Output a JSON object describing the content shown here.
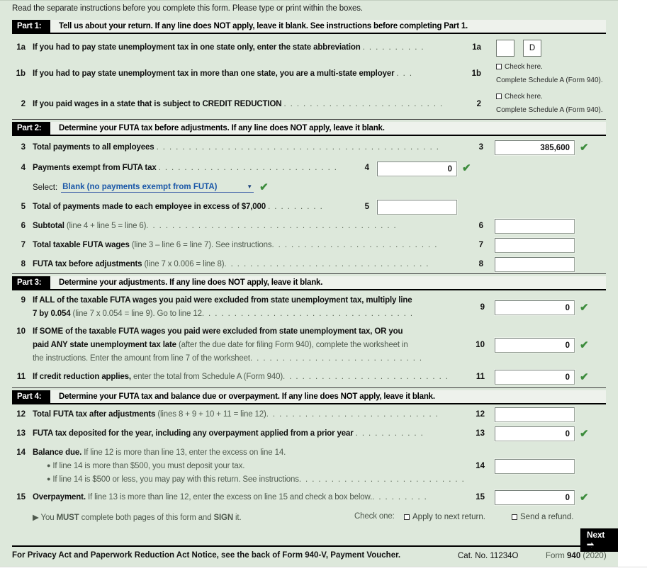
{
  "instruction": "Read the separate instructions before you complete this form. Please type or print within the boxes.",
  "colors": {
    "sheet_bg": "#dde8db",
    "part_tag_bg": "#000000",
    "check_green": "#3c8c3c",
    "select_blue": "#1a57a8"
  },
  "parts": {
    "part1": {
      "tag": "Part 1:",
      "title": "Tell us about your return. If any line does NOT apply, leave it blank. See instructions before completing Part 1."
    },
    "part2": {
      "tag": "Part 2:",
      "title": "Determine your FUTA tax before adjustments. If any line does NOT apply, leave it blank."
    },
    "part3": {
      "tag": "Part 3:",
      "title": "Determine your adjustments. If any line does NOT apply, leave it blank."
    },
    "part4": {
      "tag": "Part 4:",
      "title": "Determine your FUTA tax and balance due or overpayment. If any line does NOT apply, leave it blank."
    }
  },
  "lines": {
    "l1a": {
      "num": "1a",
      "text": "If you had to pay state unemployment tax in one state only, enter the state abbreviation",
      "leader": ". . . . . . . . . .",
      "ref": "1a",
      "state_value": "",
      "state_second_value": "D"
    },
    "l1b": {
      "num": "1b",
      "text": "If you had to pay state unemployment tax in more than one state, you are a multi-state employer",
      "leader": ". . .",
      "ref": "1b",
      "check_label": "Check here.",
      "sub_label": "Complete Schedule A (Form 940)."
    },
    "l2": {
      "num": "2",
      "text": "If you paid wages in a state that is subject to CREDIT REDUCTION",
      "leader": ". . . . . . . . . . . . . . . . . . . . . . . . .",
      "ref": "2",
      "check_label": "Check here.",
      "sub_label": "Complete Schedule A (Form 940)."
    },
    "l3": {
      "num": "3",
      "text": "Total payments to all employees",
      "leader": ". . . . . . . . . . . . . . . . . . . . . . . . . . . . . . . . . . . . . . . . . . . .",
      "ref": "3",
      "value": "385,600",
      "valid": true
    },
    "l4": {
      "num": "4",
      "text": "Payments exempt from FUTA tax",
      "leader": ". . . . . . . . . . . . . . . . . . . . . . . . . . . .",
      "ref": "4",
      "value": "0",
      "valid": true
    },
    "l4_select": {
      "label": "Select:",
      "value": "Blank (no payments exempt from FUTA)",
      "valid": true
    },
    "l5": {
      "num": "5",
      "text": "Total of payments made to each employee in excess of $7,000",
      "leader": ". . . . . . . . .",
      "ref": "5",
      "value": ""
    },
    "l6": {
      "num": "6",
      "text_bold": "Subtotal",
      "text_gray": "(line 4 + line 5 = line 6)",
      "leader": ". . . . . . . . . . . . . . . . . . . . . . . . . . . . . . . . . . . . . . .",
      "ref": "6",
      "value": ""
    },
    "l7": {
      "num": "7",
      "text_bold": "Total taxable FUTA wages",
      "text_gray": "(line 3 – line 6 = line 7). See instructions",
      "leader": ". . . . . . . . . . . . . . . . . . . . . . . . . .",
      "ref": "7",
      "value": ""
    },
    "l8": {
      "num": "8",
      "text_bold": "FUTA tax before adjustments",
      "text_gray": "(line 7 x 0.006 = line 8)",
      "leader": ". . . . . . . . . . . . . . . . . . . . . . . . . . . . . . . .",
      "ref": "8",
      "value": ""
    },
    "l9": {
      "num": "9",
      "text_l1": "If ALL of the taxable FUTA wages you paid were excluded from state unemployment tax, multiply line",
      "text_l2_bold": "7 by 0.054",
      "text_l2_gray": "(line 7 x 0.054 = line 9). Go to line 12",
      "leader": ". . . . . . . . . . . . . . . . . . . . . . . . . . . . . . . . .",
      "ref": "9",
      "value": "0",
      "valid": true
    },
    "l10": {
      "num": "10",
      "text_l1": "If SOME of the taxable FUTA wages you paid were excluded from state unemployment tax, OR you",
      "text_l2_bold": "paid ANY state unemployment tax late",
      "text_l2_gray": "(after the due date for filing Form 940), complete the worksheet in",
      "text_l3": "the instructions. Enter the amount from line 7 of the worksheet",
      "leader": ". . . . . . . . . . . . . . . . . . . . . . . . . . .",
      "ref": "10",
      "value": "0",
      "valid": true
    },
    "l11": {
      "num": "11",
      "text_bold": "If credit reduction applies,",
      "text_gray": "enter the total from Schedule A (Form 940)",
      "leader": ". . . . . . . . . . . . . . . . . . . . . . . . . .",
      "ref": "11",
      "value": "0",
      "valid": true
    },
    "l12": {
      "num": "12",
      "text_bold": "Total FUTA tax after adjustments",
      "text_gray": "(lines 8 + 9 + 10 + 11 = line 12)",
      "leader": ". . . . . . . . . . . . . . . . . . . . . . . . . . .",
      "ref": "12",
      "value": ""
    },
    "l13": {
      "num": "13",
      "text": "FUTA tax deposited for the year, including any overpayment applied from a prior year",
      "leader": ". . . . . . . . . . .",
      "ref": "13",
      "value": "0",
      "valid": true
    },
    "l14": {
      "num": "14",
      "text_bold": "Balance due.",
      "text_gray": "If line 12 is more than line 13, enter the excess on line 14.",
      "bullet1": "If line 14 is more than $500, you must deposit your tax.",
      "bullet2": "If line 14 is $500 or less, you may pay with this return. See instructions",
      "leader": ". . . . . . . . . . . . . . . . . . . . . . . . . .",
      "ref": "14",
      "value": ""
    },
    "l15": {
      "num": "15",
      "text_bold": "Overpayment.",
      "text_gray": "If line 13 is more than line 12, enter the excess on line 15 and check a box below.",
      "leader": ". . . . . . . . .",
      "ref": "15",
      "value": "0",
      "valid": true
    }
  },
  "sign_notice": {
    "arrow": "▶",
    "pre": "You ",
    "must": "MUST",
    "mid": " complete both pages of this form and ",
    "sign": "SIGN",
    "post": " it."
  },
  "check_one": {
    "label": "Check one:",
    "option1": "Apply to next return.",
    "option2": "Send a refund."
  },
  "next_button": {
    "label": "Next",
    "arrow": "➡"
  },
  "footer": {
    "notice": "For Privacy Act and Paperwork Reduction Act Notice, see the back of Form 940-V, Payment Voucher.",
    "cat_no": "Cat. No. 11234O",
    "form_pre": "Form ",
    "form_num": "940",
    "form_year": " (2020)"
  }
}
